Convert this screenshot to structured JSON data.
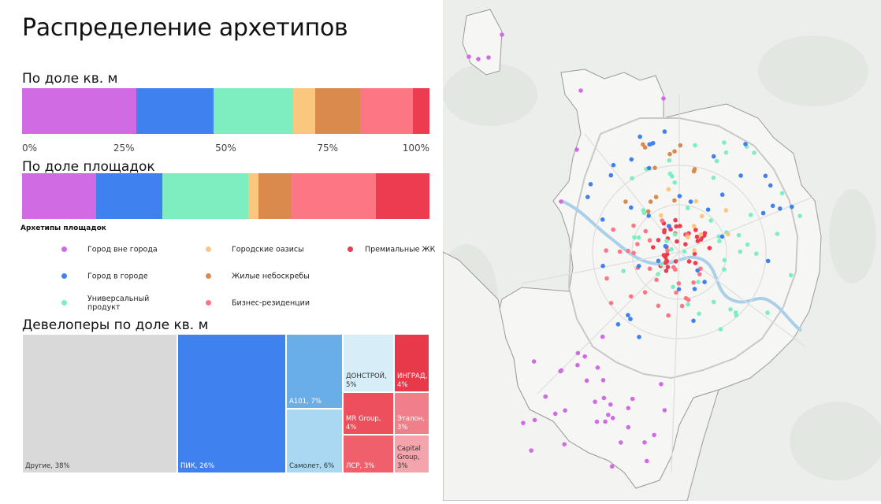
{
  "title": "Распределение архетипов",
  "sections": {
    "share_area": "По доле кв. м",
    "share_sites": "По доле площадок",
    "developers": "Девелоперы по доле кв. м"
  },
  "axis_ticks": [
    "0%",
    "25%",
    "50%",
    "75%",
    "100%"
  ],
  "legend": {
    "title": "Архетипы площадок",
    "items": [
      {
        "key": "city_outside",
        "label": "Город вне города",
        "color": "#d16be4"
      },
      {
        "key": "city_in_city",
        "label": "Город в городе",
        "color": "#3f82ef"
      },
      {
        "key": "universal",
        "label": "Универсальный продукт",
        "color": "#7eedc0"
      },
      {
        "key": "oasis",
        "label": "Городские оазисы",
        "color": "#f9c77e"
      },
      {
        "key": "skyscrapers",
        "label": "Жилые небоскребы",
        "color": "#db8a4d"
      },
      {
        "key": "business",
        "label": "Бизнес-резиденции",
        "color": "#fc7783"
      },
      {
        "key": "premium",
        "label": "Премиальные ЖК",
        "color": "#ed3b4f"
      }
    ]
  },
  "chart_data": [
    {
      "type": "bar",
      "orientation": "horizontal-stacked",
      "title": "По доле кв. м",
      "xlim": [
        0,
        100
      ],
      "x_ticks": [
        "0%",
        "25%",
        "50%",
        "75%",
        "100%"
      ],
      "series": [
        {
          "name": "Город вне города",
          "values": [
            28
          ]
        },
        {
          "name": "Город в городе",
          "values": [
            19
          ]
        },
        {
          "name": "Универсальный продукт",
          "values": [
            19.5
          ]
        },
        {
          "name": "Городские оазисы",
          "values": [
            5.5
          ]
        },
        {
          "name": "Жилые небоскребы",
          "values": [
            11
          ]
        },
        {
          "name": "Бизнес-резиденции",
          "values": [
            13
          ]
        },
        {
          "name": "Премиальные ЖК",
          "values": [
            4
          ]
        }
      ]
    },
    {
      "type": "bar",
      "orientation": "horizontal-stacked",
      "title": "По доле площадок",
      "xlim": [
        0,
        100
      ],
      "series": [
        {
          "name": "Город вне города",
          "values": [
            18
          ]
        },
        {
          "name": "Город в городе",
          "values": [
            16
          ]
        },
        {
          "name": "Универсальный продукт",
          "values": [
            21
          ]
        },
        {
          "name": "Городские оазисы",
          "values": [
            2.5
          ]
        },
        {
          "name": "Жилые небоскребы",
          "values": [
            8
          ]
        },
        {
          "name": "Бизнес-резиденции",
          "values": [
            20.5
          ]
        },
        {
          "name": "Премиальные ЖК",
          "values": [
            13
          ]
        }
      ]
    },
    {
      "type": "treemap",
      "title": "Девелоперы по доле кв. м",
      "items": [
        {
          "label": "Другие, 38%",
          "name": "Другие",
          "value": 38,
          "color": "#d9d9d9",
          "text": "dark"
        },
        {
          "label": "ПИК, 26%",
          "name": "ПИК",
          "value": 26,
          "color": "#3f82ef",
          "text": "light"
        },
        {
          "label": "A101, 7%",
          "name": "A101",
          "value": 7,
          "color": "#6aaee8",
          "text": "light"
        },
        {
          "label": "Самолет, 6%",
          "name": "Самолет",
          "value": 6,
          "color": "#aad8f2",
          "text": "dark"
        },
        {
          "label": "ДОНСТРОЙ,\n5%",
          "name": "ДОНСТРОЙ",
          "value": 5,
          "color": "#d7eef9",
          "text": "dark"
        },
        {
          "label": "ИНГРАД,\n4%",
          "name": "ИНГРАД",
          "value": 4,
          "color": "#e8394a",
          "text": "light"
        },
        {
          "label": "MR Group,\n4%",
          "name": "MR Group",
          "value": 4,
          "color": "#ee4f5d",
          "text": "light"
        },
        {
          "label": "Эталон,\n3%",
          "name": "Эталон",
          "value": 3,
          "color": "#f17f8a",
          "text": "light"
        },
        {
          "label": "ЛСР, 3%",
          "name": "ЛСР",
          "value": 3,
          "color": "#f0606c",
          "text": "light"
        },
        {
          "label": "Capital\nGroup, 3%",
          "name": "Capital Group",
          "value": 3,
          "color": "#f4a4ac",
          "text": "dark"
        }
      ]
    }
  ]
}
